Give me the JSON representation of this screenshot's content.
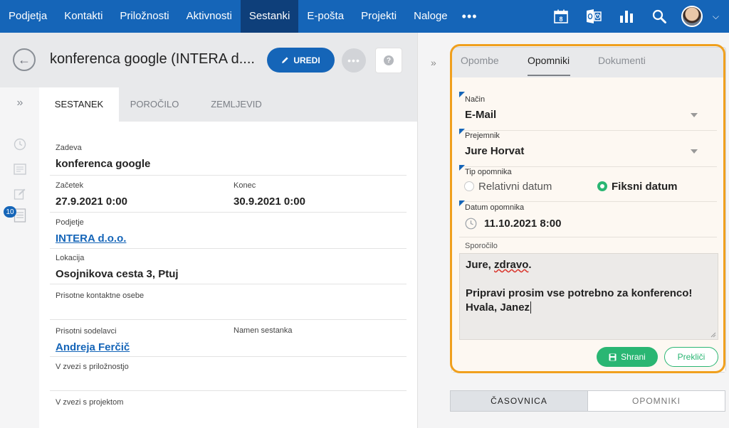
{
  "nav": {
    "items": [
      "Podjetja",
      "Kontakti",
      "Priložnosti",
      "Aktivnosti",
      "Sestanki",
      "E-pošta",
      "Projekti",
      "Naloge"
    ],
    "active": "Sestanki",
    "more": "•••",
    "calendar_day": "8",
    "icons": [
      "calendar-icon",
      "outlook-icon",
      "chart-icon",
      "search-icon"
    ],
    "chevron": "⌵"
  },
  "header": {
    "back": "←",
    "title": "konferenca google (INTERA d....",
    "edit_label": "UREDI",
    "more": "•••",
    "help": "?"
  },
  "sidebar": {
    "expand": "»",
    "badge": "10"
  },
  "tabs": [
    "SESTANEK",
    "POROČILO",
    "ZEMLJEVID"
  ],
  "form": {
    "zadeva_label": "Zadeva",
    "zadeva_value": "konferenca google",
    "zacetek_label": "Začetek",
    "zacetek_value": "27.9.2021 0:00",
    "konec_label": "Konec",
    "konec_value": "30.9.2021 0:00",
    "podjetje_label": "Podjetje",
    "podjetje_value": "INTERA d.o.o.",
    "lokacija_label": "Lokacija",
    "lokacija_value": "Osojnikova cesta 3, Ptuj",
    "kontakt_label": "Prisotne kontaktne osebe",
    "sodelavci_label": "Prisotni sodelavci",
    "sodelavci_value": "Andreja Ferčič",
    "namen_label": "Namen sestanka",
    "priloznost_label": "V zvezi s priložnostjo",
    "projekt_label": "V zvezi s projektom"
  },
  "right": {
    "collapse": "»",
    "tabs": [
      "Opombe",
      "Opomniki",
      "Dokumenti"
    ],
    "active_tab": "Opomniki",
    "nacin_label": "Način",
    "nacin_value": "E-Mail",
    "prejemnik_label": "Prejemnik",
    "prejemnik_value": "Jure Horvat",
    "tip_label": "Tip opomnika",
    "radio_relativni": "Relativni datum",
    "radio_fiksni": "Fiksni datum",
    "radio_selected": "Fiksni datum",
    "datum_label": "Datum opomnika",
    "datum_value": "11.10.2021 8:00",
    "sporocilo_label": "Sporočilo",
    "message": {
      "line1_a": "Jure, ",
      "line1_b": "zdravo",
      "line1_c": ".",
      "line2": "",
      "line3": "Pripravi prosim vse potrebno za konferenco!",
      "line4": "Hvala, Janez"
    },
    "save_label": "Shrani",
    "cancel_label": "Prekliči"
  },
  "bottom_tabs": [
    "ČASOVNICA",
    "OPOMNIKI"
  ],
  "colors": {
    "nav_bg": "#1565b8",
    "nav_active": "#0e3f7a",
    "accent_green": "#2ab673",
    "highlight": "#f0a01e",
    "link": "#1565b8"
  }
}
